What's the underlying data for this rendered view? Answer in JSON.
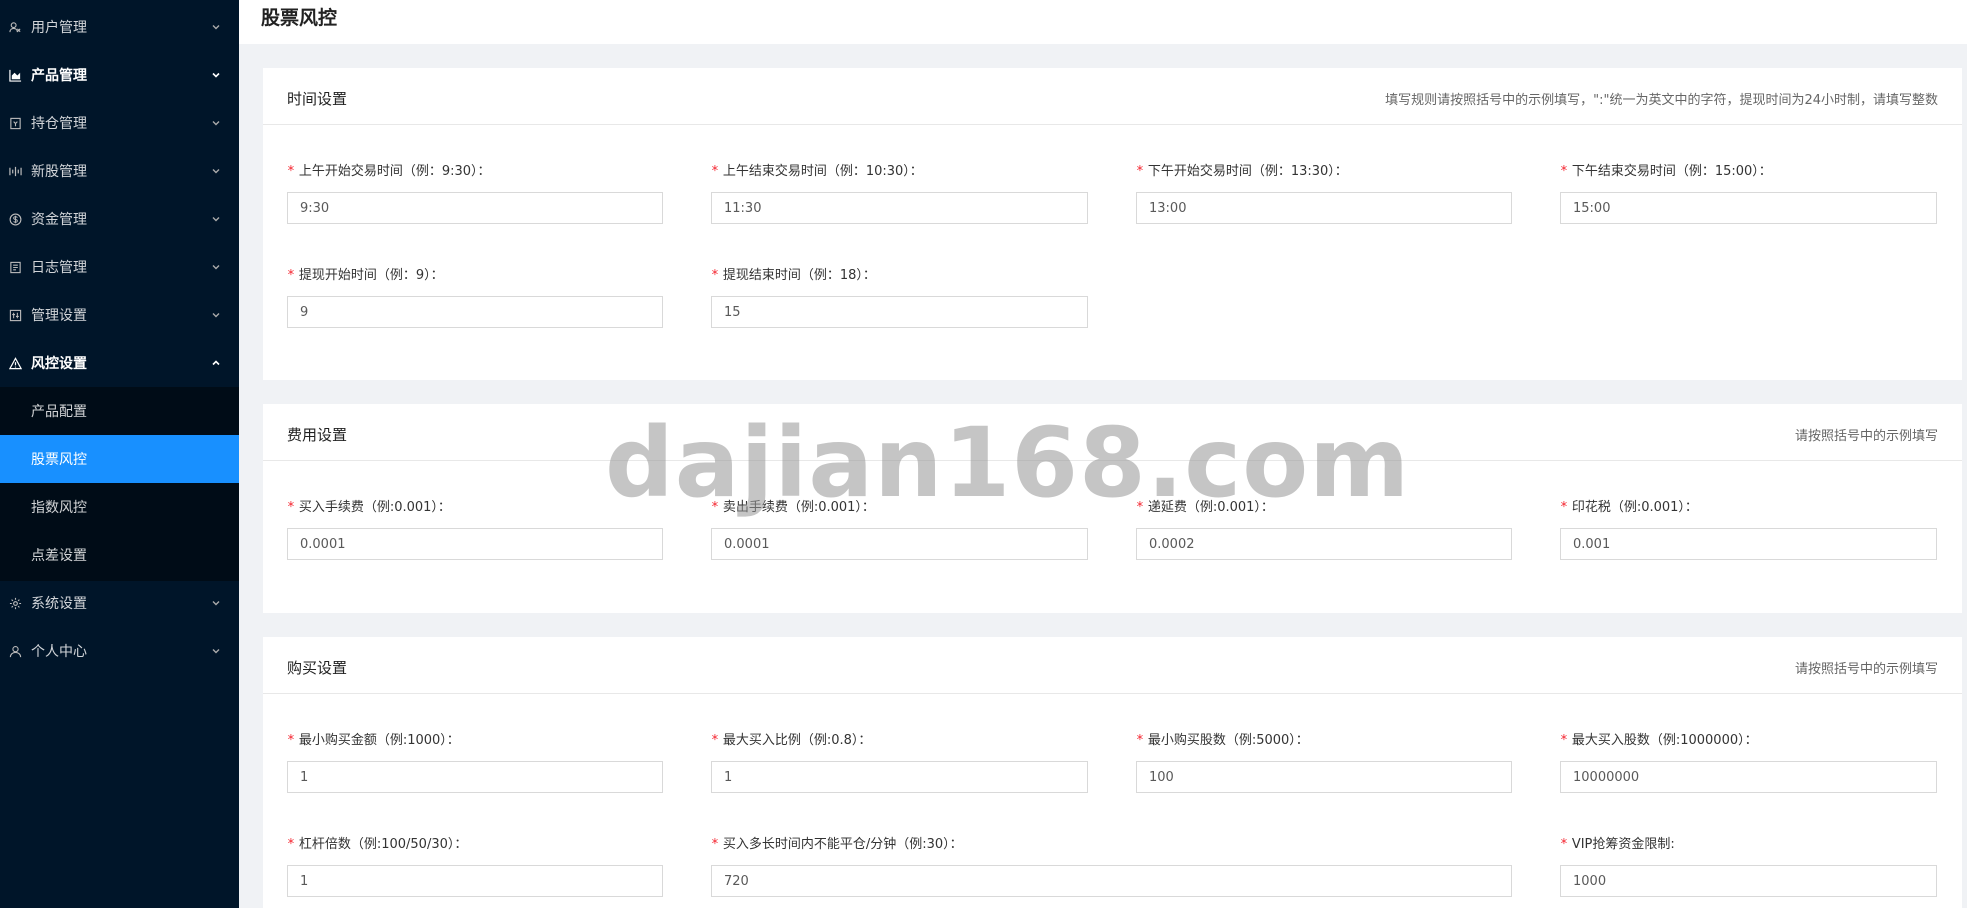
{
  "sidebar": {
    "items": [
      {
        "label": "用户管理",
        "icon": "users-icon",
        "expanded": false
      },
      {
        "label": "产品管理",
        "icon": "area-chart-icon",
        "expanded": false
      },
      {
        "label": "持仓管理",
        "icon": "position-icon",
        "expanded": false
      },
      {
        "label": "新股管理",
        "icon": "new-stock-icon",
        "expanded": false
      },
      {
        "label": "资金管理",
        "icon": "dollar-icon",
        "expanded": false
      },
      {
        "label": "日志管理",
        "icon": "log-icon",
        "expanded": false
      },
      {
        "label": "管理设置",
        "icon": "manage-settings-icon",
        "expanded": false
      },
      {
        "label": "风控设置",
        "icon": "warning-icon",
        "expanded": true,
        "children": [
          "产品配置",
          "股票风控",
          "指数风控",
          "点差设置"
        ],
        "active_child": "股票风控"
      },
      {
        "label": "系统设置",
        "icon": "gear-icon",
        "expanded": false
      },
      {
        "label": "个人中心",
        "icon": "user-icon",
        "expanded": false
      }
    ]
  },
  "page": {
    "title": "股票风控"
  },
  "sections": {
    "time": {
      "title": "时间设置",
      "hint": "填写规则请按照括号中的示例填写，\":\"统一为英文中的字符，提现时间为24小时制，请填写整数",
      "fields": [
        {
          "label": "上午开始交易时间（例：9:30）：",
          "value": "9:30"
        },
        {
          "label": "上午结束交易时间（例：10:30）：",
          "value": "11:30"
        },
        {
          "label": "下午开始交易时间（例：13:30）：",
          "value": "13:00"
        },
        {
          "label": "下午结束交易时间（例：15:00）：",
          "value": "15:00"
        },
        {
          "label": "提现开始时间（例：9）：",
          "value": "9"
        },
        {
          "label": "提现结束时间（例：18）：",
          "value": "15"
        }
      ]
    },
    "fee": {
      "title": "费用设置",
      "hint": "请按照括号中的示例填写",
      "fields": [
        {
          "label": "买入手续费（例:0.001）：",
          "value": "0.0001"
        },
        {
          "label": "卖出手续费（例:0.001）：",
          "value": "0.0001"
        },
        {
          "label": "递延费（例:0.001）：",
          "value": "0.0002"
        },
        {
          "label": "印花税（例:0.001）：",
          "value": "0.001"
        }
      ]
    },
    "buy": {
      "title": "购买设置",
      "hint": "请按照括号中的示例填写",
      "fields": [
        {
          "label": "最小购买金额（例:1000）：",
          "value": "1"
        },
        {
          "label": "最大买入比例（例:0.8）：",
          "value": "1"
        },
        {
          "label": "最小购买股数（例:5000）：",
          "value": "100"
        },
        {
          "label": "最大买入股数（例:1000000）：",
          "value": "10000000"
        },
        {
          "label": "杠杆倍数（例:100/50/30）：",
          "value": "1"
        },
        {
          "label": "买入多长时间内不能平仓/分钟（例:30）：",
          "value": "720"
        },
        {
          "label": "VIP抢筹资金限制:",
          "value": "1000"
        }
      ]
    }
  },
  "watermark": "dajian168.com"
}
